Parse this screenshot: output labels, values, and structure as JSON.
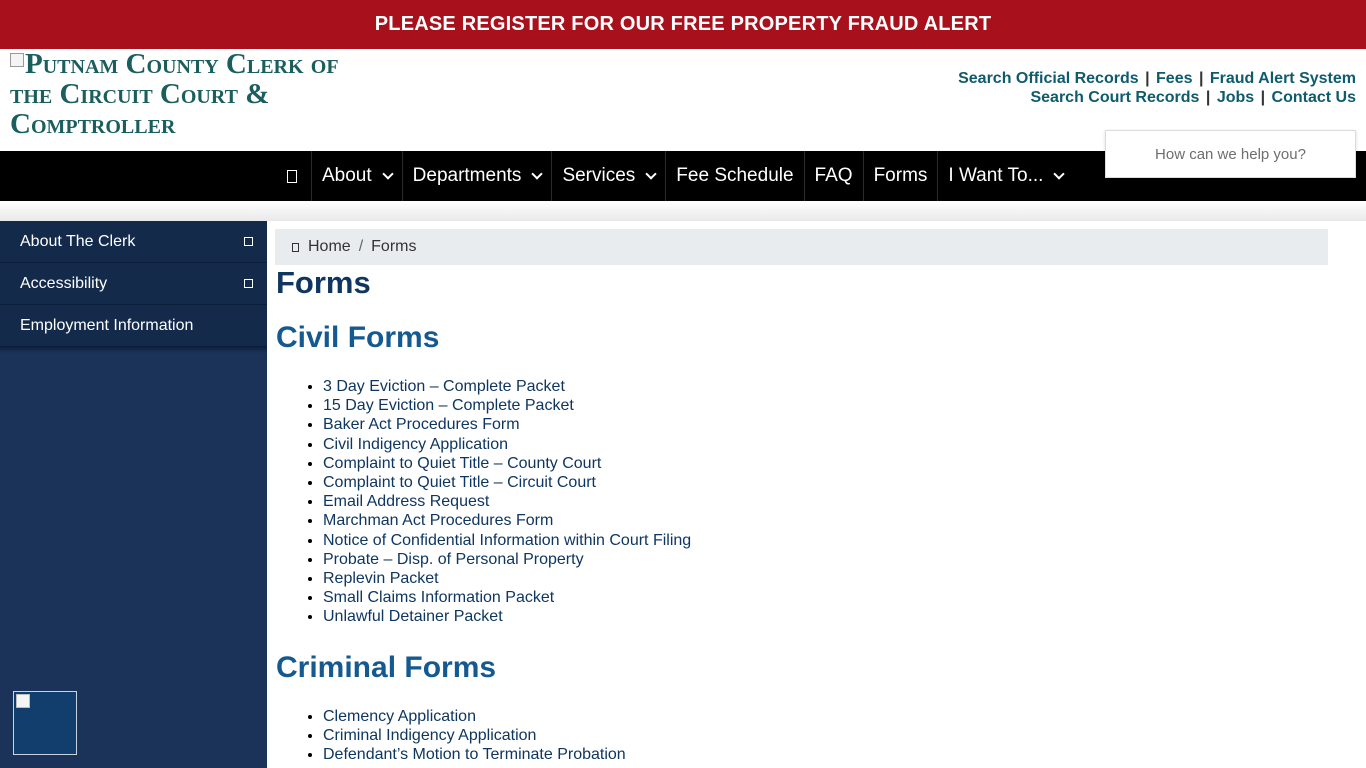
{
  "alert": {
    "text": "PLEASE REGISTER FOR OUR FREE PROPERTY FRAUD ALERT"
  },
  "logo": {
    "alt": "Putnam County Clerk of the Circuit Court & Comptroller"
  },
  "top_links": {
    "row1": [
      "Search Official Records",
      "Fees",
      "Fraud Alert System"
    ],
    "row2": [
      "Search Court Records",
      "Jobs",
      "Contact Us"
    ],
    "separator": "|"
  },
  "nav": {
    "home_icon": "home-icon",
    "items": [
      {
        "label": "About",
        "dropdown": true
      },
      {
        "label": "Departments",
        "dropdown": true
      },
      {
        "label": "Services",
        "dropdown": true
      },
      {
        "label": "Fee Schedule",
        "dropdown": false
      },
      {
        "label": "FAQ",
        "dropdown": false
      },
      {
        "label": "Forms",
        "dropdown": false
      },
      {
        "label": "I Want To...",
        "dropdown": true
      }
    ]
  },
  "search": {
    "placeholder": "How can we help you?"
  },
  "sidebar": {
    "items": [
      {
        "label": "About The Clerk",
        "expandable": true
      },
      {
        "label": "Accessibility",
        "expandable": true
      },
      {
        "label": "Employment Information",
        "expandable": false
      }
    ]
  },
  "breadcrumb": {
    "home": "Home",
    "separator": "/",
    "current": "Forms"
  },
  "page": {
    "title": "Forms"
  },
  "civil": {
    "heading": "Civil Forms",
    "items": [
      "3 Day Eviction – Complete Packet",
      "15 Day Eviction – Complete Packet",
      "Baker Act Procedures Form",
      "Civil Indigency Application",
      "Complaint to Quiet Title – County Court",
      "Complaint to Quiet Title – Circuit Court",
      "Email Address Request",
      "Marchman Act Procedures Form",
      "Notice of Confidential Information within Court Filing",
      "Probate – Disp. of Personal Property",
      "Replevin Packet",
      "Small Claims Information Packet",
      "Unlawful Detainer Packet"
    ]
  },
  "criminal": {
    "heading": "Criminal Forms",
    "items": [
      "Clemency Application",
      "Criminal Indigency Application",
      "Defendant’s Motion to Terminate Probation"
    ]
  },
  "colors": {
    "alert": "#a8101c",
    "nav": "#000000",
    "sidebar": "#1b3358",
    "title": "#0f3660",
    "section": "#14598f"
  }
}
